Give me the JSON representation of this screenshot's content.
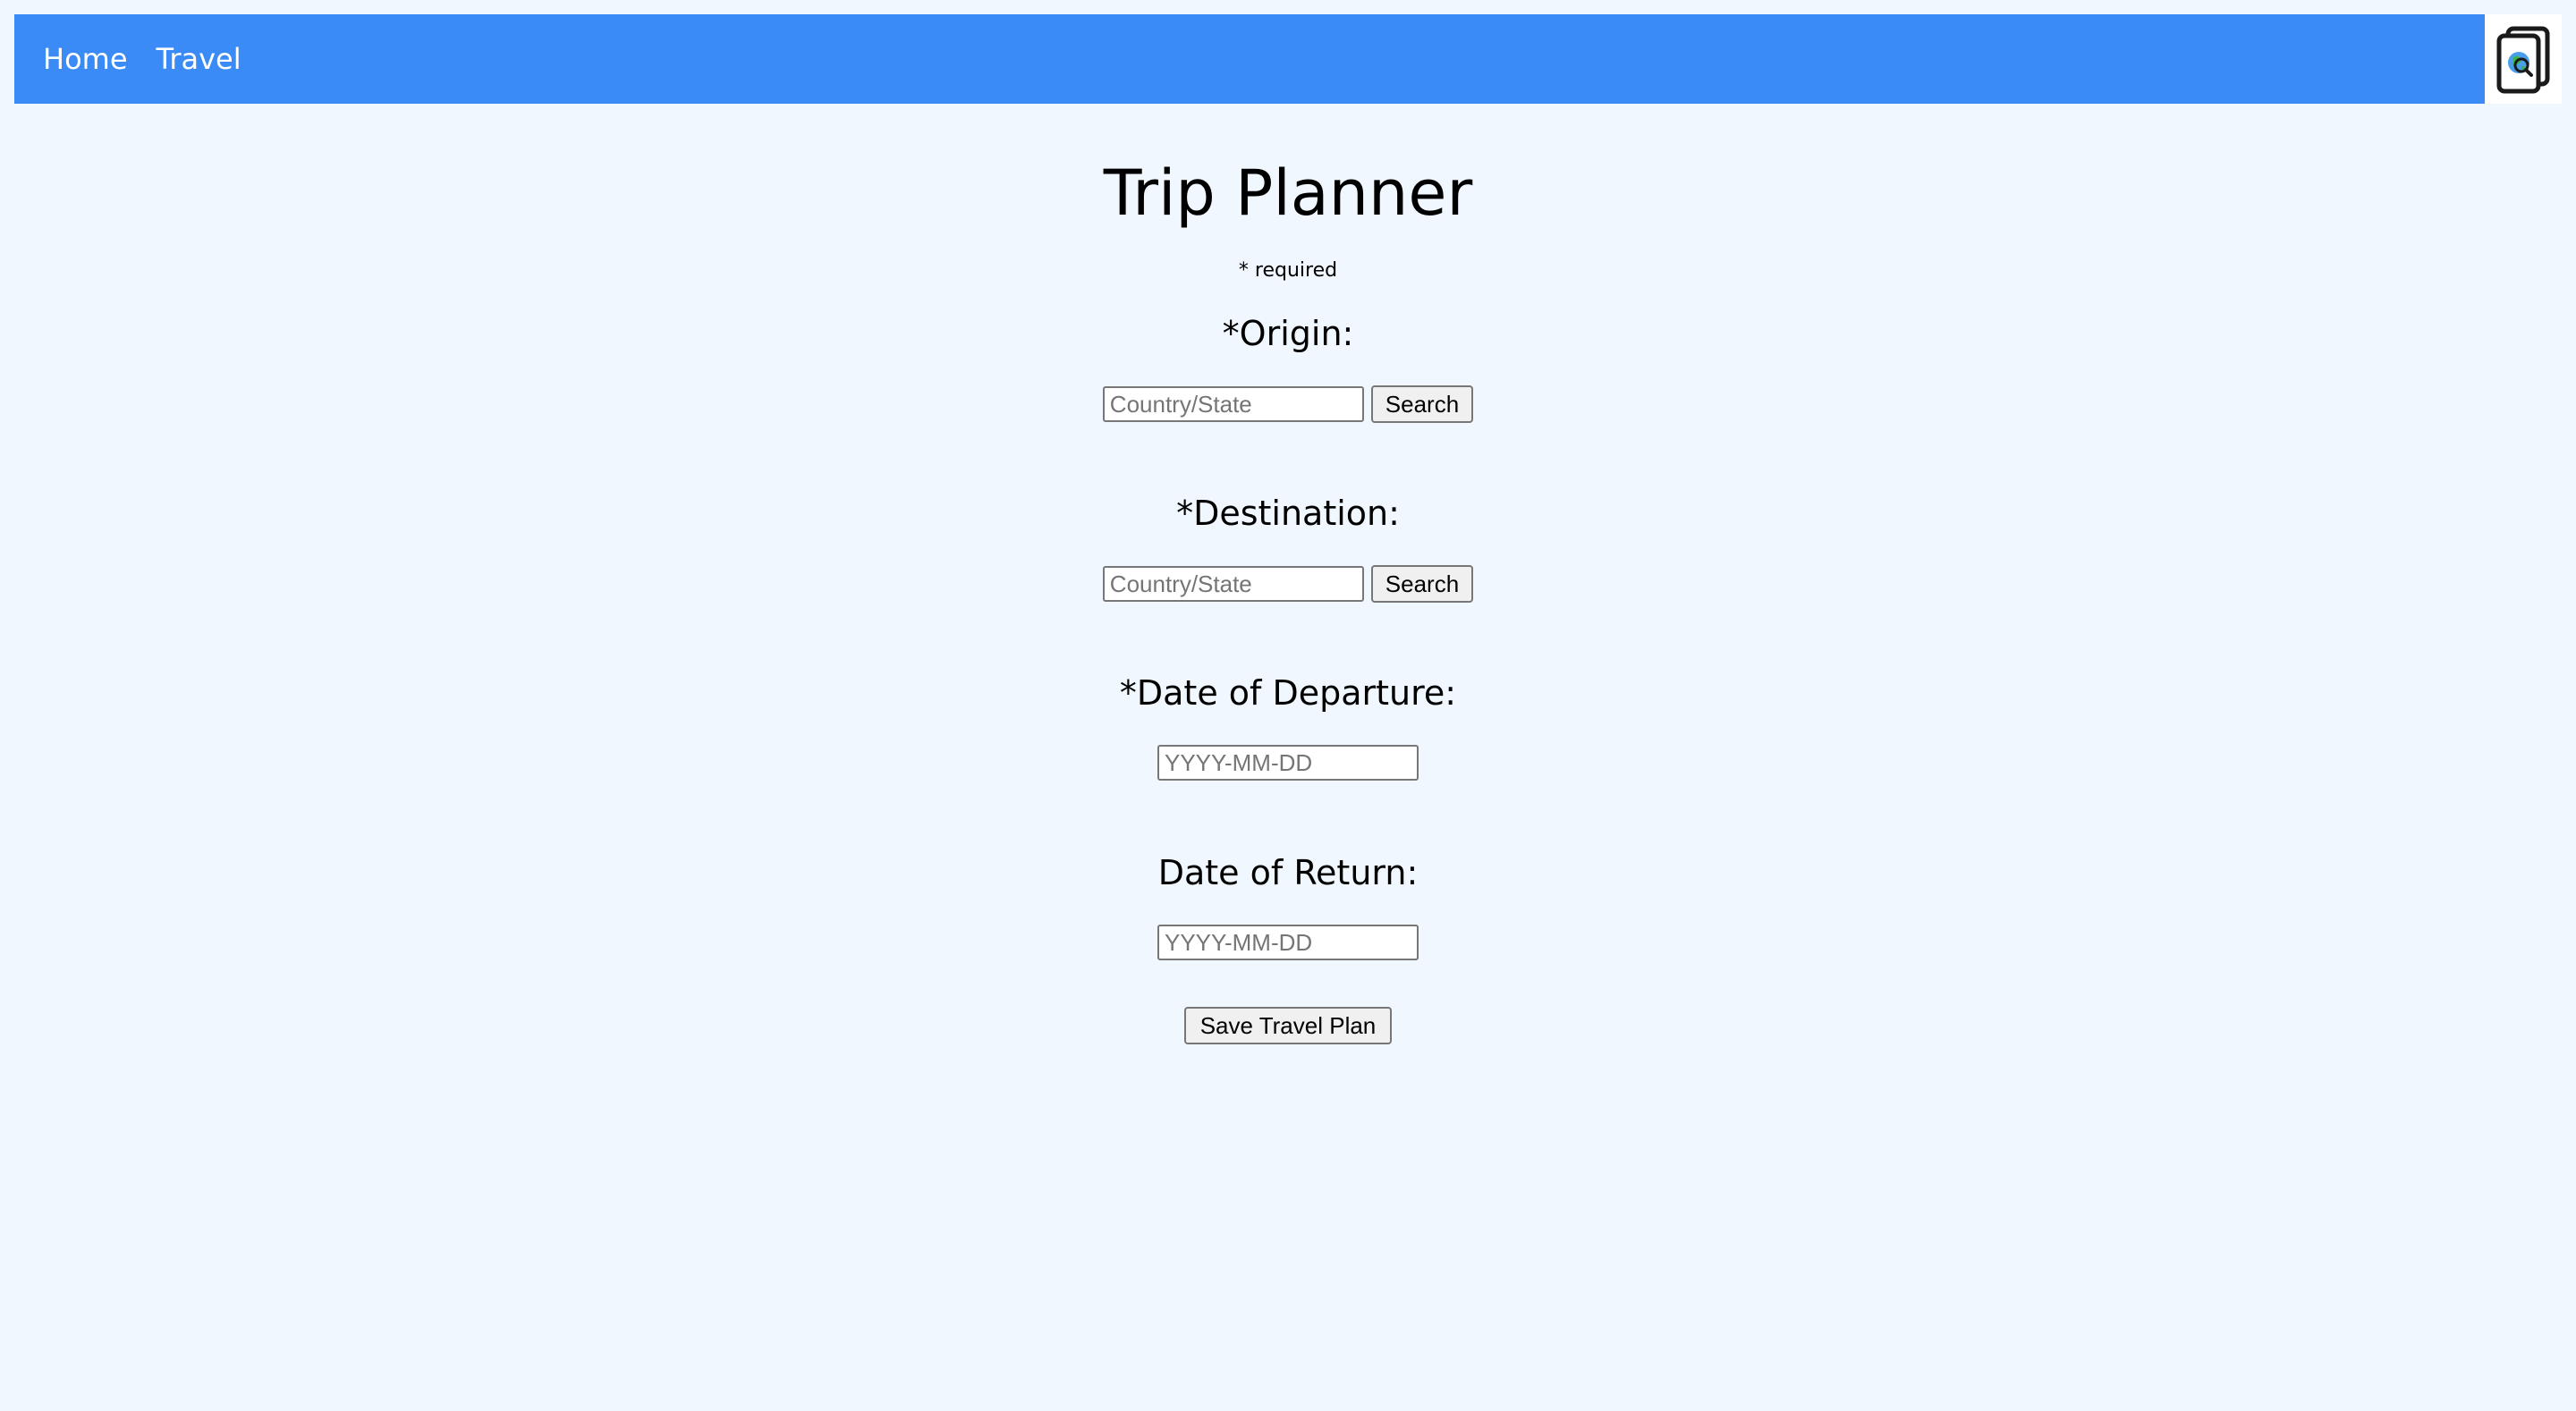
{
  "nav": {
    "items": [
      {
        "label": "Home"
      },
      {
        "label": "Travel"
      }
    ],
    "background": "#3b8bf7"
  },
  "logo": {
    "icon": "travel-documents-globe-icon"
  },
  "page": {
    "title": "Trip Planner",
    "required_note": "* required"
  },
  "form": {
    "origin": {
      "label": "*Origin:",
      "placeholder": "Country/State",
      "value": "",
      "button_label": "Search"
    },
    "destination": {
      "label": "*Destination:",
      "placeholder": "Country/State",
      "value": "",
      "button_label": "Search"
    },
    "departure": {
      "label": "*Date of Departure:",
      "placeholder": "YYYY-MM-DD",
      "value": ""
    },
    "return": {
      "label": "Date of Return:",
      "placeholder": "YYYY-MM-DD",
      "value": ""
    },
    "save_label": "Save Travel Plan"
  },
  "colors": {
    "page_background": "#f0f7ff",
    "nav_background": "#3b8bf7",
    "nav_text": "#ffffff"
  }
}
